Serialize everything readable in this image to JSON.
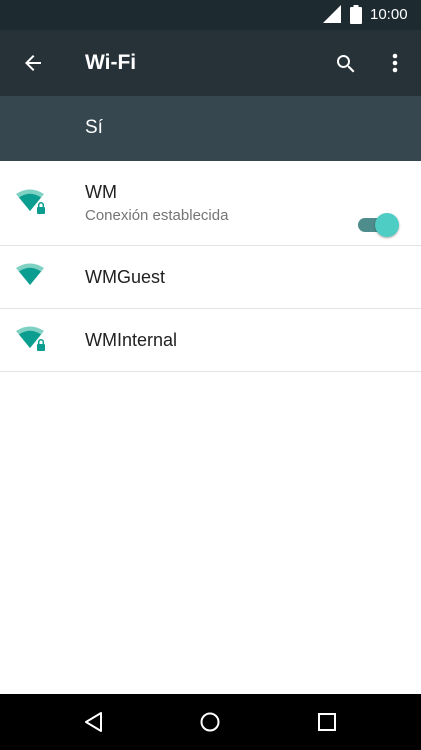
{
  "status_bar": {
    "time": "10:00",
    "signal_icon": "cell-signal-icon",
    "battery_icon": "battery-full-icon"
  },
  "app_bar": {
    "title": "Wi-Fi",
    "back_icon": "arrow-back-icon",
    "search_icon": "search-icon",
    "more_icon": "more-vert-icon"
  },
  "wifi_toggle": {
    "label": "Sí",
    "state": "on"
  },
  "networks": [
    {
      "name": "WM",
      "status": "Conexión establecida",
      "secured": true
    },
    {
      "name": "WMGuest",
      "status": "",
      "secured": false
    },
    {
      "name": "WMInternal",
      "status": "",
      "secured": true
    }
  ],
  "nav_bar": {
    "back_icon": "nav-back-icon",
    "home_icon": "nav-home-icon",
    "recents_icon": "nav-recents-icon"
  },
  "colors": {
    "status_bar": "#1d2b30",
    "app_bar": "#263238",
    "toggle_row": "#37474f",
    "accent": "#4ecdc4",
    "wifi_icon": "#0b9d8f"
  }
}
